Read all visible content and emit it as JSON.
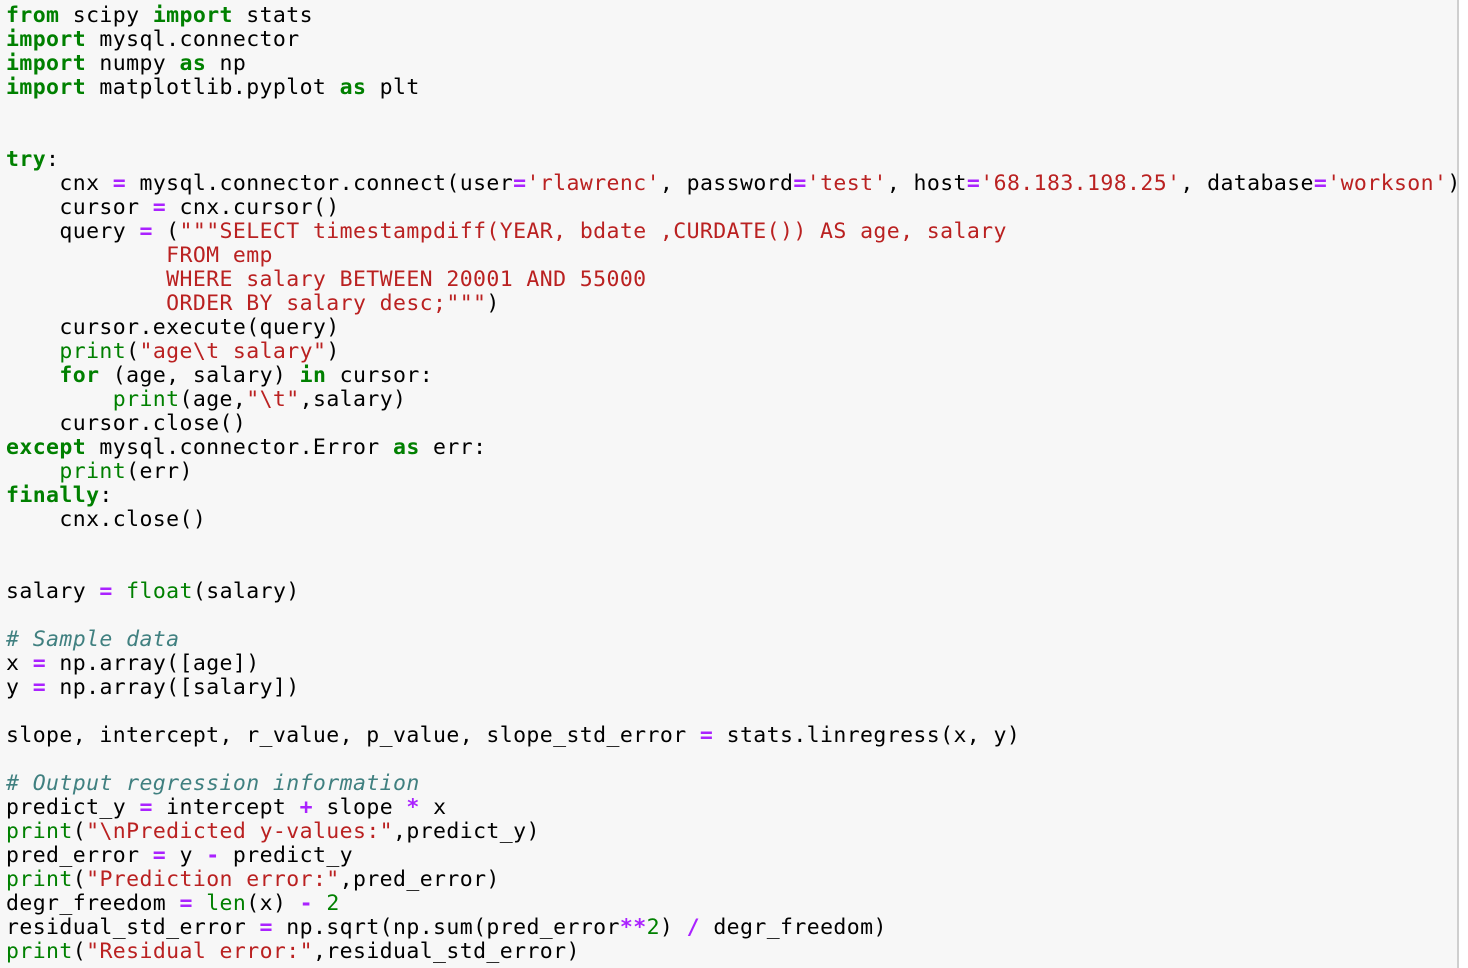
{
  "colors": {
    "keyword": "#008000",
    "string": "#ba2121",
    "operator": "#aa22ff",
    "comment": "#408080",
    "background": "#f7f7f7"
  },
  "lines": [
    [
      [
        "kw",
        "from"
      ],
      [
        "t",
        " scipy "
      ],
      [
        "kw",
        "import"
      ],
      [
        "t",
        " stats"
      ]
    ],
    [
      [
        "kw",
        "import"
      ],
      [
        "t",
        " mysql.connector"
      ]
    ],
    [
      [
        "kw",
        "import"
      ],
      [
        "t",
        " numpy "
      ],
      [
        "kw",
        "as"
      ],
      [
        "t",
        " np"
      ]
    ],
    [
      [
        "kw",
        "import"
      ],
      [
        "t",
        " matplotlib.pyplot "
      ],
      [
        "kw",
        "as"
      ],
      [
        "t",
        " plt"
      ]
    ],
    [],
    [],
    [
      [
        "kw",
        "try"
      ],
      [
        "t",
        ":"
      ]
    ],
    [
      [
        "t",
        "    cnx "
      ],
      [
        "op",
        "="
      ],
      [
        "t",
        " mysql.connector.connect(user"
      ],
      [
        "op",
        "="
      ],
      [
        "str",
        "'rlawrenc'"
      ],
      [
        "t",
        ", password"
      ],
      [
        "op",
        "="
      ],
      [
        "str",
        "'test'"
      ],
      [
        "t",
        ", host"
      ],
      [
        "op",
        "="
      ],
      [
        "str",
        "'68.183.198.25'"
      ],
      [
        "t",
        ", database"
      ],
      [
        "op",
        "="
      ],
      [
        "str",
        "'workson'"
      ],
      [
        "t",
        ")"
      ]
    ],
    [
      [
        "t",
        "    cursor "
      ],
      [
        "op",
        "="
      ],
      [
        "t",
        " cnx.cursor()"
      ]
    ],
    [
      [
        "t",
        "    query "
      ],
      [
        "op",
        "="
      ],
      [
        "t",
        " ("
      ],
      [
        "str",
        "\"\"\"SELECT timestampdiff(YEAR, bdate ,CURDATE()) AS age, salary"
      ]
    ],
    [
      [
        "str",
        "            FROM emp"
      ]
    ],
    [
      [
        "str",
        "            WHERE salary BETWEEN 20001 AND 55000"
      ]
    ],
    [
      [
        "str",
        "            ORDER BY salary desc;\"\"\""
      ],
      [
        "t",
        ")"
      ]
    ],
    [
      [
        "t",
        "    cursor.execute(query)"
      ]
    ],
    [
      [
        "t",
        "    "
      ],
      [
        "bi",
        "print"
      ],
      [
        "t",
        "("
      ],
      [
        "str",
        "\"age\\t salary\""
      ],
      [
        "t",
        ")"
      ]
    ],
    [
      [
        "t",
        "    "
      ],
      [
        "kw",
        "for"
      ],
      [
        "t",
        " (age, salary) "
      ],
      [
        "kw",
        "in"
      ],
      [
        "t",
        " cursor:"
      ]
    ],
    [
      [
        "t",
        "        "
      ],
      [
        "bi",
        "print"
      ],
      [
        "t",
        "(age,"
      ],
      [
        "str",
        "\"\\t\""
      ],
      [
        "t",
        ",salary)"
      ]
    ],
    [
      [
        "t",
        "    cursor.close()"
      ]
    ],
    [
      [
        "kw",
        "except"
      ],
      [
        "t",
        " mysql.connector.Error "
      ],
      [
        "kw",
        "as"
      ],
      [
        "t",
        " err:"
      ]
    ],
    [
      [
        "t",
        "    "
      ],
      [
        "bi",
        "print"
      ],
      [
        "t",
        "(err)"
      ]
    ],
    [
      [
        "kw",
        "finally"
      ],
      [
        "t",
        ":"
      ]
    ],
    [
      [
        "t",
        "    cnx.close()"
      ]
    ],
    [],
    [],
    [
      [
        "t",
        "salary "
      ],
      [
        "op",
        "="
      ],
      [
        "t",
        " "
      ],
      [
        "bi",
        "float"
      ],
      [
        "t",
        "(salary)"
      ]
    ],
    [],
    [
      [
        "cm",
        "# Sample data"
      ]
    ],
    [
      [
        "t",
        "x "
      ],
      [
        "op",
        "="
      ],
      [
        "t",
        " np.array([age])"
      ]
    ],
    [
      [
        "t",
        "y "
      ],
      [
        "op",
        "="
      ],
      [
        "t",
        " np.array([salary])"
      ]
    ],
    [],
    [
      [
        "t",
        "slope, intercept, r_value, p_value, slope_std_error "
      ],
      [
        "op",
        "="
      ],
      [
        "t",
        " stats.linregress(x, y)"
      ]
    ],
    [],
    [
      [
        "cm",
        "# Output regression information"
      ]
    ],
    [
      [
        "t",
        "predict_y "
      ],
      [
        "op",
        "="
      ],
      [
        "t",
        " intercept "
      ],
      [
        "op",
        "+"
      ],
      [
        "t",
        " slope "
      ],
      [
        "op",
        "*"
      ],
      [
        "t",
        " x"
      ]
    ],
    [
      [
        "bi",
        "print"
      ],
      [
        "t",
        "("
      ],
      [
        "str",
        "\"\\nPredicted y-values:\""
      ],
      [
        "t",
        ",predict_y)"
      ]
    ],
    [
      [
        "t",
        "pred_error "
      ],
      [
        "op",
        "="
      ],
      [
        "t",
        " y "
      ],
      [
        "op",
        "-"
      ],
      [
        "t",
        " predict_y"
      ]
    ],
    [
      [
        "bi",
        "print"
      ],
      [
        "t",
        "("
      ],
      [
        "str",
        "\"Prediction error:\""
      ],
      [
        "t",
        ",pred_error)"
      ]
    ],
    [
      [
        "t",
        "degr_freedom "
      ],
      [
        "op",
        "="
      ],
      [
        "t",
        " "
      ],
      [
        "bi",
        "len"
      ],
      [
        "t",
        "(x) "
      ],
      [
        "op",
        "-"
      ],
      [
        "t",
        " "
      ],
      [
        "num",
        "2"
      ]
    ],
    [
      [
        "t",
        "residual_std_error "
      ],
      [
        "op",
        "="
      ],
      [
        "t",
        " np.sqrt(np.sum(pred_error"
      ],
      [
        "op",
        "**"
      ],
      [
        "num",
        "2"
      ],
      [
        "t",
        ") "
      ],
      [
        "op",
        "/"
      ],
      [
        "t",
        " degr_freedom)"
      ]
    ],
    [
      [
        "bi",
        "print"
      ],
      [
        "t",
        "("
      ],
      [
        "str",
        "\"Residual error:\""
      ],
      [
        "t",
        ",residual_std_error)"
      ]
    ]
  ]
}
